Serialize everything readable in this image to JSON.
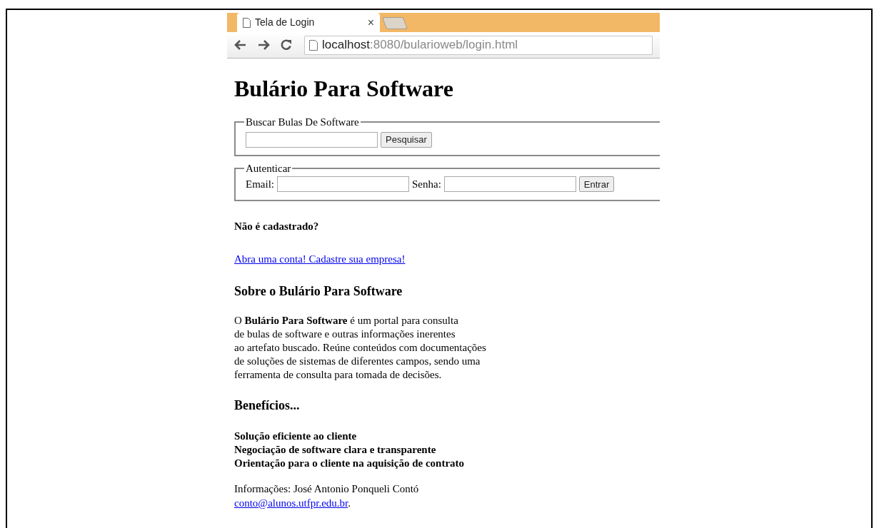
{
  "browser": {
    "tab": {
      "title": "Tela de Login",
      "close": "×",
      "selected": true
    },
    "url_host": "localhost",
    "url_path": ":8080/bularioweb/login.html"
  },
  "page": {
    "title": "Bulário Para Software",
    "search_group": {
      "legend": "Buscar Bulas De Software",
      "button": "Pesquisar"
    },
    "auth_group": {
      "legend": "Autenticar",
      "email_label": "Email:",
      "password_label": "Senha:",
      "button": "Entrar"
    },
    "signup_question": "Não é cadastrado?",
    "signup_link": "Abra uma conta! Cadastre sua empresa!",
    "about_heading": "Sobre o Bulário Para Software",
    "about_lines": [
      "O **Bulário Para Software** é um portal para consulta",
      "de bulas de software e outras informações inerentes",
      "ao artefato buscado. Reúne conteúdos com documentações",
      "de soluções de sistemas de diferentes campos, sendo uma",
      "ferramenta de consulta para tomada de decisões."
    ],
    "benefits_heading": "Benefícios...",
    "benefits": [
      "Solução eficiente ao cliente",
      "Negociação de software clara e transparente",
      "Orientação para o cliente na aquisição de contrato"
    ],
    "contact_text": "Informações: José Antonio Ponqueli Contó",
    "contact_email": "conto@alunos.utfpr.edu.br",
    "contact_end": "."
  }
}
